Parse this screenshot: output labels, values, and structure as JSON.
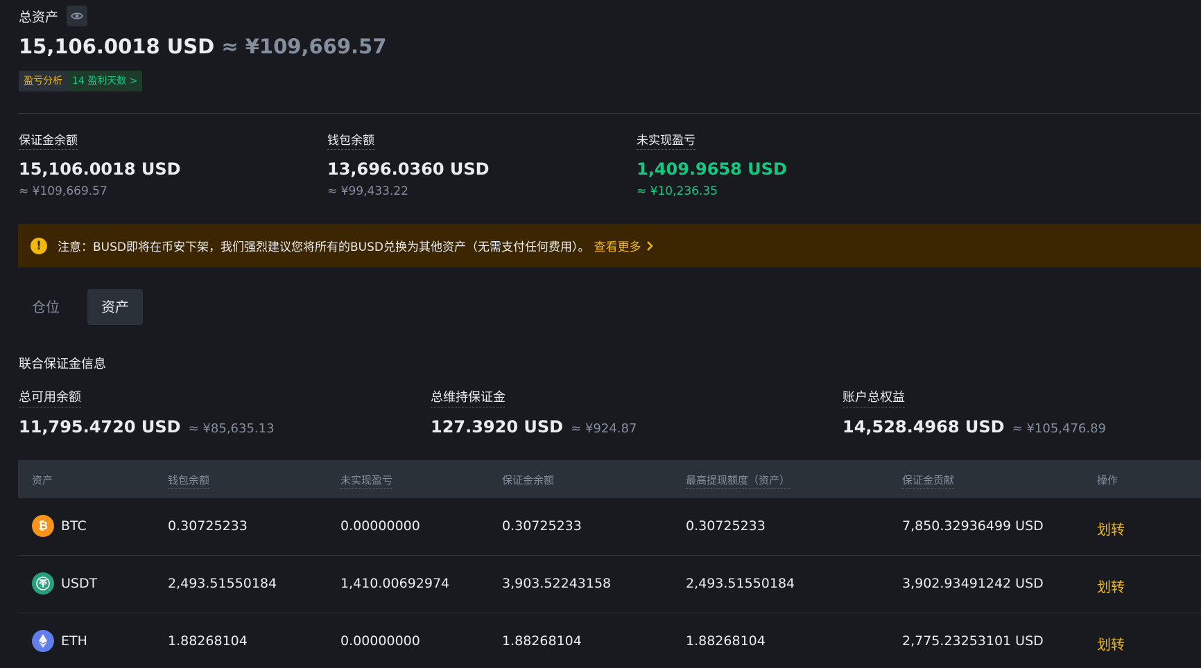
{
  "header": {
    "title": "总资产",
    "total_usd": "15,106.0018 USD",
    "total_cny": "≈ ¥109,669.57",
    "pnl_analysis_label": "盈亏分析",
    "profit_days_label": "14 盈利天数 >"
  },
  "summary": [
    {
      "label": "保证金余额",
      "value": "15,106.0018 USD",
      "sub": "≈ ¥109,669.57"
    },
    {
      "label": "钱包余额",
      "value": "13,696.0360 USD",
      "sub": "≈ ¥99,433.22"
    },
    {
      "label": "未实现盈亏",
      "value": "1,409.9658 USD",
      "sub": "≈ ¥10,236.35"
    }
  ],
  "notice": {
    "text": "注意：BUSD即将在币安下架，我们强烈建议您将所有的BUSD兑换为其他资产（无需支付任何费用）。",
    "link": "查看更多"
  },
  "tabs": [
    {
      "label": "仓位",
      "active": false
    },
    {
      "label": "资产",
      "active": true
    }
  ],
  "section_title": "联合保证金信息",
  "margin_info": [
    {
      "label": "总可用余额",
      "value": "11,795.4720 USD",
      "sub": "≈ ¥85,635.13"
    },
    {
      "label": "总维持保证金",
      "value": "127.3920 USD",
      "sub": "≈ ¥924.87"
    },
    {
      "label": "账户总权益",
      "value": "14,528.4968 USD",
      "sub": "≈ ¥105,476.89"
    }
  ],
  "table": {
    "headers": [
      "资产",
      "钱包余额",
      "未实现盈亏",
      "保证金余额",
      "最高提现额度（资产）",
      "保证金贡献",
      "操作"
    ],
    "rows": [
      {
        "asset": "BTC",
        "icon": "btc-icon",
        "wallet": "0.30725233",
        "unrealized": "0.00000000",
        "margin": "0.30725233",
        "max_withdraw": "0.30725233",
        "contribution": "7,850.32936499 USD",
        "action": "划转"
      },
      {
        "asset": "USDT",
        "icon": "usdt-icon",
        "wallet": "2,493.51550184",
        "unrealized": "1,410.00692974",
        "margin": "3,903.52243158",
        "max_withdraw": "2,493.51550184",
        "contribution": "3,902.93491242 USD",
        "action": "划转"
      },
      {
        "asset": "ETH",
        "icon": "eth-icon",
        "wallet": "1.88268104",
        "unrealized": "0.00000000",
        "margin": "1.88268104",
        "max_withdraw": "1.88268104",
        "contribution": "2,775.23253101 USD",
        "action": "划转"
      }
    ]
  },
  "colors": {
    "background": "#181A20",
    "accent": "#F0B90B",
    "positive": "#0ECB81",
    "muted": "#848E9C",
    "notice_bg": "#3C2601"
  }
}
